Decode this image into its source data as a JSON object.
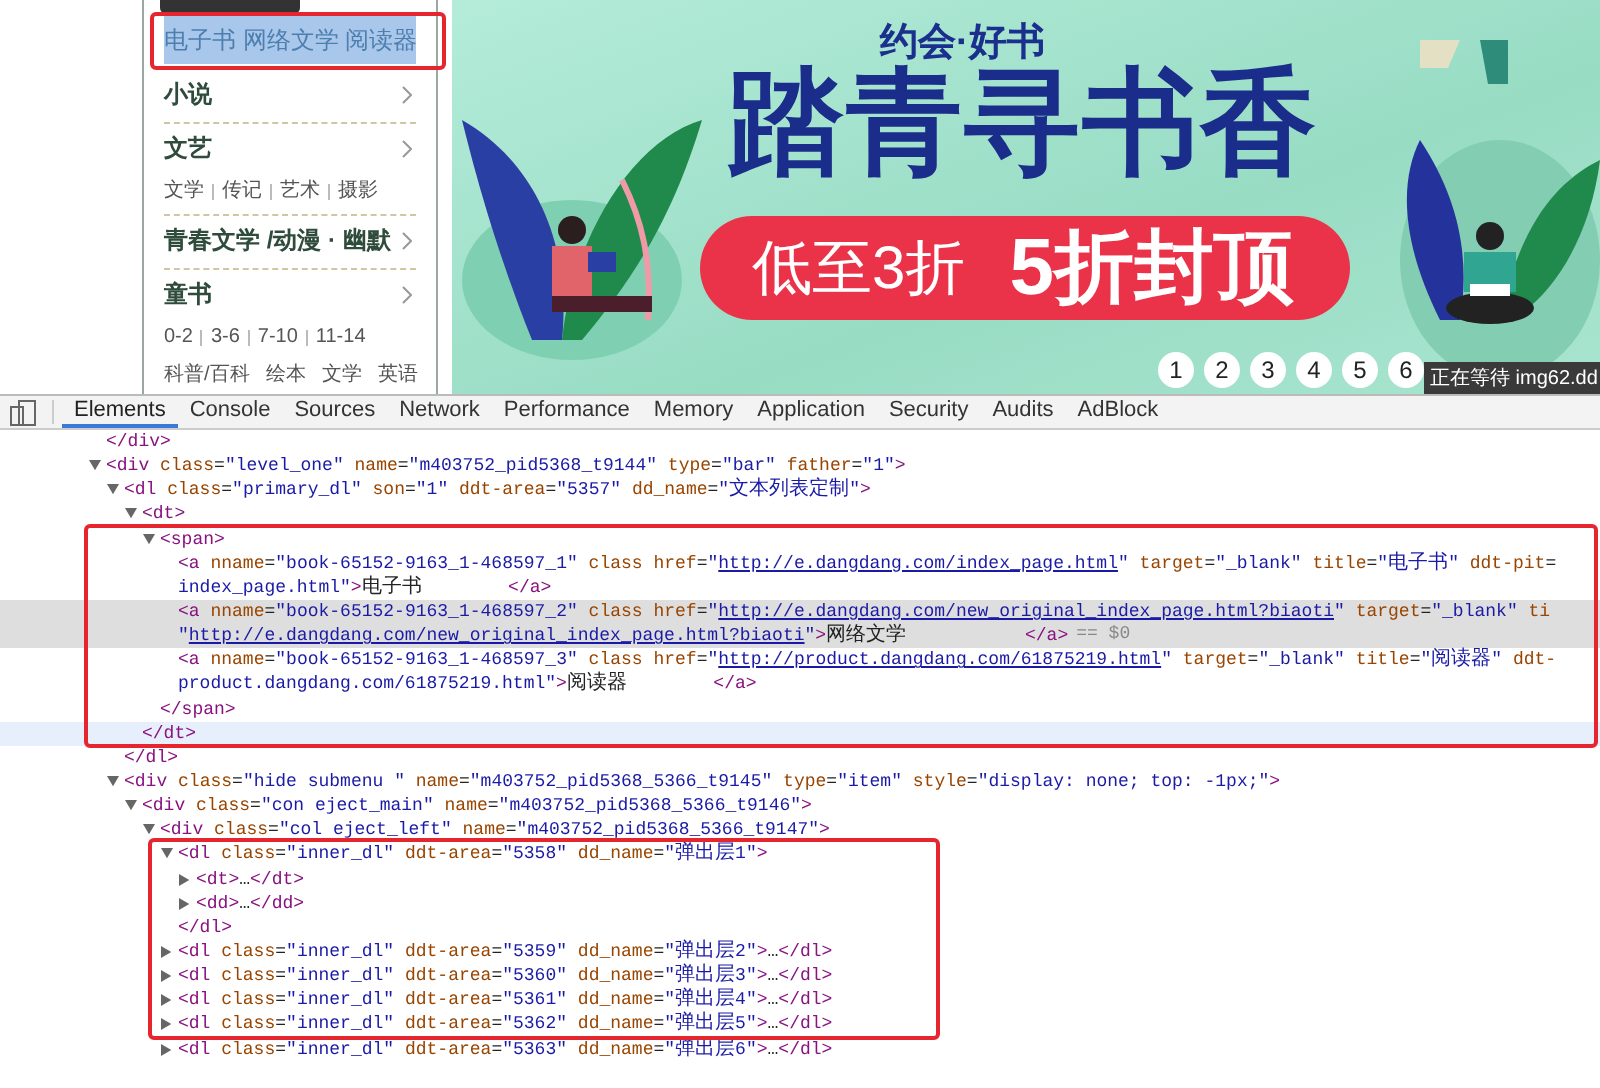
{
  "sidebar": {
    "items": [
      {
        "title": "电子书 网络文学 阅读器",
        "selected": true,
        "framed": true
      },
      {
        "title": "小说",
        "selected": false,
        "framed": false
      },
      {
        "title": "文艺",
        "selected": false,
        "framed": false,
        "links": [
          [
            "文学",
            "传记",
            "艺术",
            "摄影"
          ]
        ]
      },
      {
        "title": "青春文学 /动漫 · 幽默",
        "selected": false,
        "framed": false
      },
      {
        "title": "童书",
        "selected": false,
        "framed": false,
        "links": [
          [
            "0-2",
            "3-6",
            "7-10",
            "11-14"
          ],
          [
            "科普/百科",
            "绘本",
            "文学",
            "英语"
          ]
        ]
      }
    ]
  },
  "banner": {
    "tagline": "约会·好书",
    "headline": "踏青寻书香",
    "discount": "低至3折",
    "cap": "5折封顶",
    "pager": [
      {
        "label": "1",
        "selected": false
      },
      {
        "label": "2",
        "selected": false
      },
      {
        "label": "3",
        "selected": false
      },
      {
        "label": "4",
        "selected": false
      },
      {
        "label": "5",
        "selected": false
      },
      {
        "label": "6",
        "selected": false
      }
    ],
    "status": "正在等待 img62.dd"
  },
  "devtools": {
    "tabs": [
      {
        "label": "Elements",
        "selected": true
      },
      {
        "label": "Console",
        "selected": false
      },
      {
        "label": "Sources",
        "selected": false
      },
      {
        "label": "Network",
        "selected": false
      },
      {
        "label": "Performance",
        "selected": false
      },
      {
        "label": "Memory",
        "selected": false
      },
      {
        "label": "Application",
        "selected": false
      },
      {
        "label": "Security",
        "selected": false
      },
      {
        "label": "Audits",
        "selected": false
      },
      {
        "label": "AdBlock",
        "selected": false
      }
    ],
    "dom_tree": [
      {
        "open": [
          "</div>"
        ],
        "selected": false
      },
      {
        "open": [
          "<div class=\"level_one\" name=\"m403752_pid5368_t9144\" type=\"bar\" father=\"1\">"
        ],
        "expanded": true,
        "selected": false,
        "children": [
          {
            "open": [
              "<dl class=\"primary_dl\" son=\"1\" ddt-area=\"5357\" dd_name=\"文本列表定制\">"
            ],
            "expanded": true,
            "selected": false,
            "close": "</dl>",
            "children": [
              {
                "open": [
                  "<dt>"
                ],
                "expanded": true,
                "selected": false,
                "close": "</dt>",
                "close_hovered": true,
                "close_framed": true,
                "children": [
                  {
                    "open": [
                      "<span>"
                    ],
                    "expanded": true,
                    "selected": false,
                    "framed": true,
                    "close": "</span>",
                    "children": [
                      {
                        "open": [
                          "<a nname=\"book-65152-9163_1-468597_1\" class href=\"http://e.dangdang.com/index_page.html\" target=\"_blank\" title=\"电子书\" ddt-pit=",
                          "index_page.html\">电子书        </a>"
                        ],
                        "selected": false
                      },
                      {
                        "open": [
                          "<a nname=\"book-65152-9163_1-468597_2\" class href=\"http://e.dangdang.com/new_original_index_page.html?biaoti\" target=\"_blank\" ti",
                          "\"http://e.dangdang.com/new_original_index_page.html?biaoti\">网络文学           </a>"
                        ],
                        "selected": true,
                        "console_ref": "== $0"
                      },
                      {
                        "open": [
                          "<a nname=\"book-65152-9163_1-468597_3\" class href=\"http://product.dangdang.com/61875219.html\" target=\"_blank\" title=\"阅读器\" ddt-",
                          "product.dangdang.com/61875219.html\">阅读器        </a>"
                        ],
                        "selected": false
                      }
                    ]
                  }
                ]
              }
            ]
          },
          {
            "open": [
              "<div class=\"hide submenu \" name=\"m403752_pid5368_5366_t9145\" type=\"item\" style=\"display: none; top: -1px;\">"
            ],
            "expanded": true,
            "selected": false,
            "children": [
              {
                "open": [
                  "<div class=\"con eject_main\" name=\"m403752_pid5368_5366_t9146\">"
                ],
                "expanded": true,
                "selected": false,
                "children": [
                  {
                    "open": [
                      "<div class=\"col eject_left\" name=\"m403752_pid5368_5366_t9147\">"
                    ],
                    "expanded": true,
                    "selected": false,
                    "children": [
                      {
                        "open": [
                          "<dl class=\"inner_dl\" ddt-area=\"5358\" dd_name=\"弹出层1\">"
                        ],
                        "expanded": true,
                        "selected": false,
                        "framed": true,
                        "close": "</dl>",
                        "children": [
                          {
                            "open": [
                              "<dt>…</dt>"
                            ],
                            "expanded": false,
                            "selected": false
                          },
                          {
                            "open": [
                              "<dd>…</dd>"
                            ],
                            "expanded": false,
                            "selected": false
                          }
                        ]
                      },
                      {
                        "open": [
                          "<dl class=\"inner_dl\" ddt-area=\"5359\" dd_name=\"弹出层2\">…</dl>"
                        ],
                        "expanded": false,
                        "selected": false,
                        "framed": true
                      },
                      {
                        "open": [
                          "<dl class=\"inner_dl\" ddt-area=\"5360\" dd_name=\"弹出层3\">…</dl>"
                        ],
                        "expanded": false,
                        "selected": false,
                        "framed": true
                      },
                      {
                        "open": [
                          "<dl class=\"inner_dl\" ddt-area=\"5361\" dd_name=\"弹出层4\">…</dl>"
                        ],
                        "expanded": false,
                        "selected": false,
                        "framed": true
                      },
                      {
                        "open": [
                          "<dl class=\"inner_dl\" ddt-area=\"5362\" dd_name=\"弹出层5\">…</dl>"
                        ],
                        "expanded": false,
                        "selected": false,
                        "framed": true
                      },
                      {
                        "open": [
                          "<dl class=\"inner_dl\" ddt-area=\"5363\" dd_name=\"弹出层6\">…</dl>"
                        ],
                        "expanded": false,
                        "selected": false,
                        "framed": false
                      }
                    ]
                  }
                ]
              }
            ]
          }
        ]
      }
    ]
  }
}
